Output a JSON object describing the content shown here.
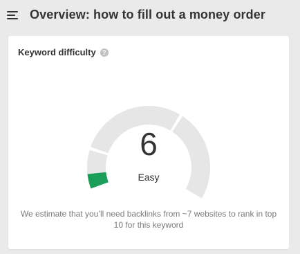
{
  "header": {
    "title": "Overview: how to fill out a money order"
  },
  "card": {
    "title": "Keyword difficulty",
    "help_glyph": "?",
    "score": "6",
    "score_value": 6,
    "score_max": 100,
    "level": "Easy",
    "description": "We estimate that you’ll need backlinks from ~7 websites to rank in top 10 for this keyword"
  },
  "colors": {
    "gauge_fill": "#1a9e5a",
    "gauge_track": "#e6e6e6",
    "text": "#333333",
    "muted_text": "#7a7a7a"
  },
  "icons": {
    "menu": "menu-icon",
    "help": "help-icon"
  }
}
